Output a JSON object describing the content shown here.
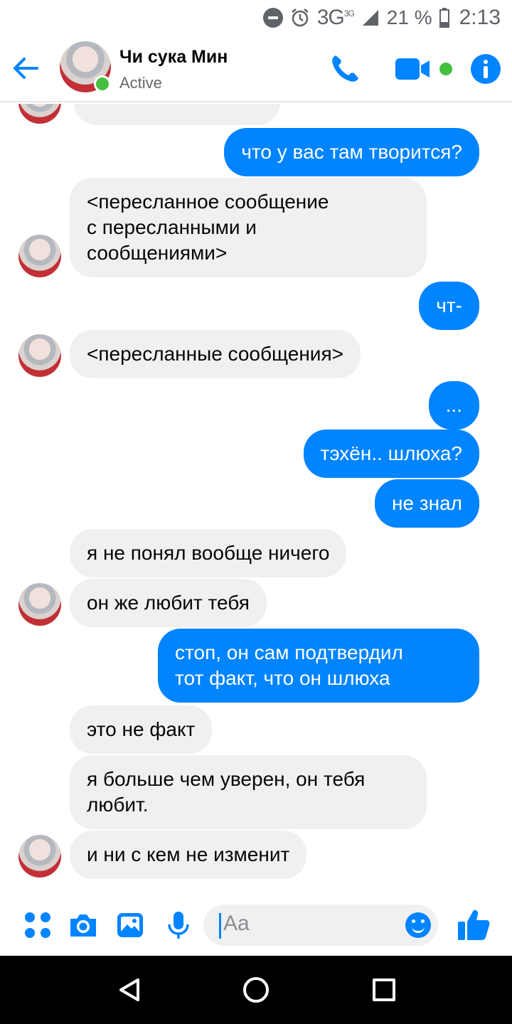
{
  "status_bar": {
    "network": "3G",
    "network_sup": "3G",
    "battery": "21 %",
    "time": "2:13"
  },
  "header": {
    "contact_name": "Чи сука Мин",
    "status": "Active"
  },
  "messages": {
    "m0": "что у вас там творится?",
    "m1_line1": "<пересланное сообщение",
    "m1_line2": "с пересланными и",
    "m1_line3": "сообщениями>",
    "m2": "чт-",
    "m3": "<пересланные сообщения>",
    "m4": "...",
    "m5": "тэхён.. шлюха?",
    "m6": "не знал",
    "m7": "я не понял вообще ничего",
    "m8": "он же любит тебя",
    "m9_line1": "стоп, он сам подтвердил",
    "m9_line2": "тот факт, что он шлюха",
    "m10": "это не факт",
    "m11_line1": "я больше чем уверен, он тебя",
    "m11_line2": "любит.",
    "m12": "и ни с кем не изменит"
  },
  "composer": {
    "placeholder": "Aa"
  },
  "colors": {
    "accent": "#0084ff",
    "incoming_bubble": "#f1f0f0",
    "online": "#44bf40"
  }
}
